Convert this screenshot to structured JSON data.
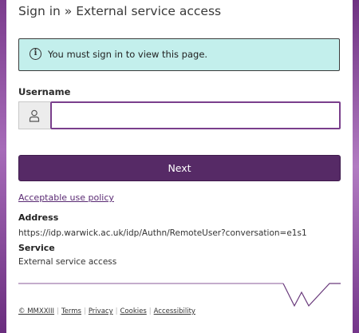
{
  "header": {
    "title": "Sign in » External service access"
  },
  "alert": {
    "icon": "info-circle-icon",
    "message": "You must sign in to view this page."
  },
  "form": {
    "username_label": "Username",
    "username_icon": "user-icon",
    "username_value": "",
    "username_placeholder": "",
    "next_label": "Next"
  },
  "links": {
    "acceptable_use_policy": "Acceptable use policy"
  },
  "details": {
    "address_label": "Address",
    "address_value": "https://idp.warwick.ac.uk/idp/Authn/RemoteUser?conversation=e1s1",
    "service_label": "Service",
    "service_value": "External service access"
  },
  "footer": {
    "copyright": "© MMXXIII",
    "links": [
      "Terms",
      "Privacy",
      "Cookies",
      "Accessibility"
    ],
    "logo": "warwick-w-logo"
  },
  "colors": {
    "primary": "#562a66",
    "alert_bg": "#c3efec",
    "link": "#5a2a73",
    "input_focus": "#7a3f8c"
  }
}
